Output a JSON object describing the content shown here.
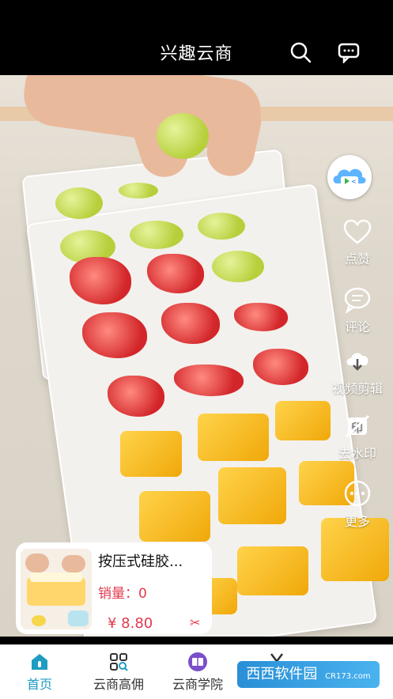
{
  "header": {
    "title": "兴趣云商",
    "icons": [
      "search-icon",
      "message-icon"
    ]
  },
  "actions": {
    "avatar_icon": "cloud-logo-icon",
    "like_label": "点赞",
    "comment_label": "评论",
    "edit_label": "视频剪辑",
    "watermark_label": "去水印",
    "more_label": "更多"
  },
  "product": {
    "name": "按压式硅胶...",
    "sales_label": "销量：",
    "sales_value": "0",
    "price": "¥ 8.80",
    "scissor": "✂"
  },
  "tabs": [
    {
      "label": "首页",
      "active": true,
      "icon": "home-icon"
    },
    {
      "label": "云商高佣",
      "active": false,
      "icon": "grid-search-icon"
    },
    {
      "label": "云商学院",
      "active": false,
      "icon": "book-icon"
    },
    {
      "label": "",
      "active": false,
      "icon": "scissors-icon"
    }
  ],
  "watermark": {
    "text": "西西软件园",
    "sub": "CR173.com"
  },
  "colors": {
    "accent": "#1e9cc2",
    "price": "#e23a4f"
  }
}
